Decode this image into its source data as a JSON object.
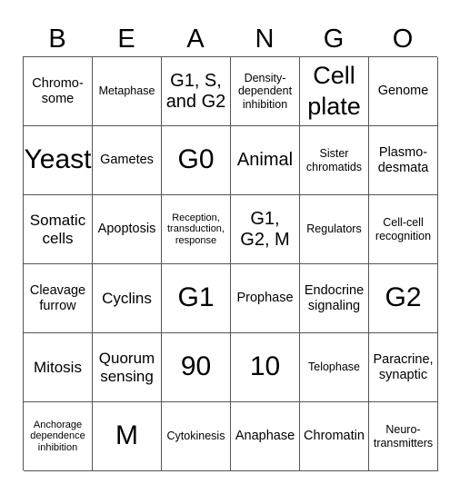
{
  "title_letters": [
    "B",
    "E",
    "A",
    "N",
    "G",
    "O"
  ],
  "board": [
    [
      {
        "text": "Chromo-\nsome",
        "size": "md"
      },
      {
        "text": "Metaphase",
        "size": "sm"
      },
      {
        "text": "G1, S,\nand G2",
        "size": "xl"
      },
      {
        "text": "Density-\ndependent\ninhibition",
        "size": "sm"
      },
      {
        "text": "Cell\nplate",
        "size": "xxl"
      },
      {
        "text": "Genome",
        "size": "md"
      }
    ],
    [
      {
        "text": "Yeast",
        "size": "big"
      },
      {
        "text": "Gametes",
        "size": "md"
      },
      {
        "text": "G0",
        "size": "big"
      },
      {
        "text": "Animal",
        "size": "xl"
      },
      {
        "text": "Sister\nchromatids",
        "size": "sm"
      },
      {
        "text": "Plasmo-\ndesmata",
        "size": "md"
      }
    ],
    [
      {
        "text": "Somatic\ncells",
        "size": "lg"
      },
      {
        "text": "Apoptosis",
        "size": "md"
      },
      {
        "text": "Reception,\ntransduction,\nresponse",
        "size": "xs"
      },
      {
        "text": "G1,\nG2, M",
        "size": "xl"
      },
      {
        "text": "Regulators",
        "size": "sm"
      },
      {
        "text": "Cell-cell\nrecognition",
        "size": "sm"
      }
    ],
    [
      {
        "text": "Cleavage\nfurrow",
        "size": "md"
      },
      {
        "text": "Cyclins",
        "size": "lg"
      },
      {
        "text": "G1",
        "size": "big"
      },
      {
        "text": "Prophase",
        "size": "md"
      },
      {
        "text": "Endocrine\nsignaling",
        "size": "md"
      },
      {
        "text": "G2",
        "size": "big"
      }
    ],
    [
      {
        "text": "Mitosis",
        "size": "lg"
      },
      {
        "text": "Quorum\nsensing",
        "size": "lg"
      },
      {
        "text": "90",
        "size": "big"
      },
      {
        "text": "10",
        "size": "big"
      },
      {
        "text": "Telophase",
        "size": "sm"
      },
      {
        "text": "Paracrine,\nsynaptic",
        "size": "md"
      }
    ],
    [
      {
        "text": "Anchorage\ndependence\ninhibition",
        "size": "xs"
      },
      {
        "text": "M",
        "size": "big"
      },
      {
        "text": "Cytokinesis",
        "size": "sm"
      },
      {
        "text": "Anaphase",
        "size": "md"
      },
      {
        "text": "Chromatin",
        "size": "md"
      },
      {
        "text": "Neuro-\ntransmitters",
        "size": "sm"
      }
    ]
  ]
}
